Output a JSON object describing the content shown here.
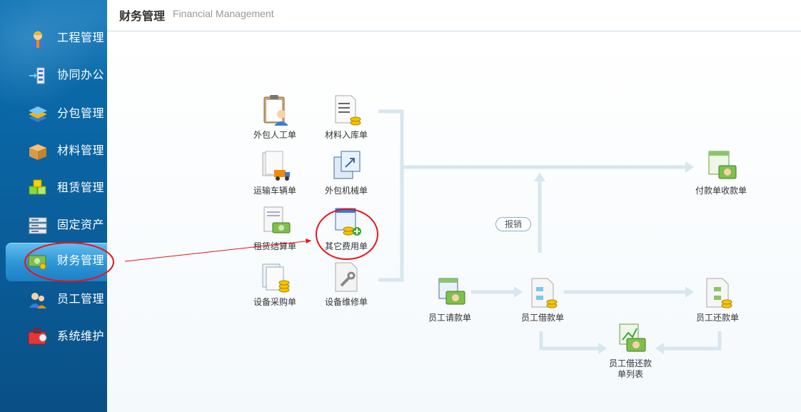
{
  "header": {
    "title_cn": "财务管理",
    "title_en": "Financial Management"
  },
  "sidebar": {
    "items": [
      {
        "label": "工程管理",
        "icon": "worker-icon"
      },
      {
        "label": "协同办公",
        "icon": "collaboration-icon"
      },
      {
        "label": "分包管理",
        "icon": "layers-icon"
      },
      {
        "label": "材料管理",
        "icon": "box-icon"
      },
      {
        "label": "租赁管理",
        "icon": "cubes-icon"
      },
      {
        "label": "固定资产",
        "icon": "server-icon"
      },
      {
        "label": "财务管理",
        "icon": "money-icon",
        "active": true
      },
      {
        "label": "员工管理",
        "icon": "users-icon"
      },
      {
        "label": "系统维护",
        "icon": "toolbox-icon"
      }
    ]
  },
  "workflow": {
    "nodes": {
      "outsource_labor": "外包人工单",
      "material_in": "材料入库单",
      "transport": "运输车辆单",
      "outsource_machine": "外包机械单",
      "lease_settle": "租赁结算单",
      "other_expense": "其它费用单",
      "equip_purchase": "设备采购单",
      "equip_repair": "设备维修单",
      "payment": "付款单收款单",
      "staff_request": "员工请款单",
      "staff_loan": "员工借款单",
      "staff_repay": "员工还款单",
      "loan_list_line1": "员工借还款",
      "loan_list_line2": "单列表"
    },
    "reimburse_label": "报销"
  },
  "annotation_color": "#e8141c"
}
